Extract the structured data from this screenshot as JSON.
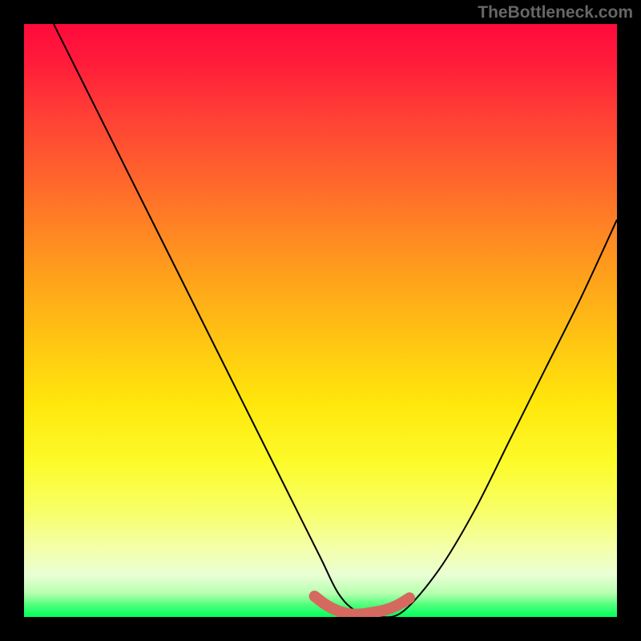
{
  "watermark": "TheBottleneck.com",
  "chart_data": {
    "type": "line",
    "title": "",
    "xlabel": "",
    "ylabel": "",
    "xlim": [
      0,
      100
    ],
    "ylim": [
      0,
      100
    ],
    "grid": false,
    "series": [
      {
        "name": "curve",
        "x": [
          5,
          10,
          15,
          20,
          25,
          30,
          35,
          40,
          45,
          50,
          53,
          56,
          60,
          64,
          70,
          76,
          82,
          88,
          94,
          100
        ],
        "values": [
          100,
          90,
          80,
          70,
          60,
          50,
          40,
          30,
          20,
          10,
          4,
          1,
          0,
          1,
          8,
          18,
          30,
          42,
          54,
          67
        ]
      },
      {
        "name": "valley-overlay",
        "x": [
          49,
          51,
          53,
          55,
          57,
          59,
          61,
          63,
          65
        ],
        "values": [
          3.5,
          2.0,
          1.0,
          0.5,
          0.5,
          0.8,
          1.2,
          2.0,
          3.2
        ]
      }
    ],
    "gradient_stops": [
      {
        "pos": 0,
        "color": "#ff0a3c"
      },
      {
        "pos": 50,
        "color": "#ffc712"
      },
      {
        "pos": 100,
        "color": "#00ff5c"
      }
    ],
    "valley_color": "#d6695f"
  }
}
